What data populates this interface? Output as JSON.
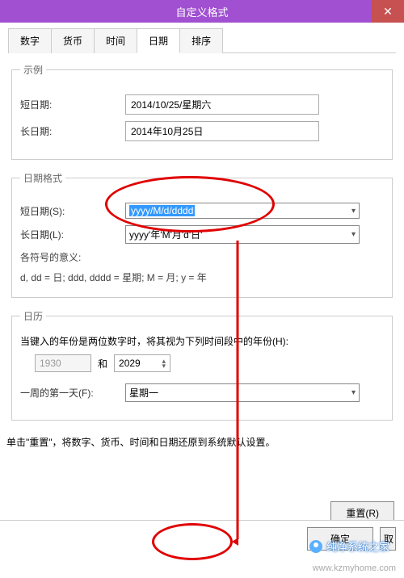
{
  "window": {
    "title": "自定义格式",
    "close": "✕"
  },
  "tabs": [
    "数字",
    "货币",
    "时间",
    "日期",
    "排序"
  ],
  "activeTabIndex": 3,
  "example": {
    "legend": "示例",
    "shortLabel": "短日期:",
    "shortValue": "2014/10/25/星期六",
    "longLabel": "长日期:",
    "longValue": "2014年10月25日"
  },
  "format": {
    "legend": "日期格式",
    "shortLabel": "短日期(S):",
    "shortValue": "yyyy/M/d/dddd",
    "longLabel": "长日期(L):",
    "longValue": "yyyy'年'M'月'd'日'",
    "meaningTitle": "各符号的意义:",
    "meaningText": "d, dd = 日;  ddd, dddd = 星期;  M = 月;  y = 年"
  },
  "calendar": {
    "legend": "日历",
    "twoDigitLabel": "当键入的年份是两位数字时，将其视为下列时间段中的年份(H):",
    "yearFrom": "1930",
    "and": "和",
    "yearTo": "2029",
    "firstDayLabel": "一周的第一天(F):",
    "firstDayValue": "星期一"
  },
  "resetHint": "单击\"重置\"，将数字、货币、时间和日期还原到系统默认设置。",
  "buttons": {
    "reset": "重置(R)",
    "ok": "确定",
    "cancel": "取"
  },
  "branding": {
    "name": "纯净系统之家",
    "url": "www.kzmyhome.com"
  }
}
